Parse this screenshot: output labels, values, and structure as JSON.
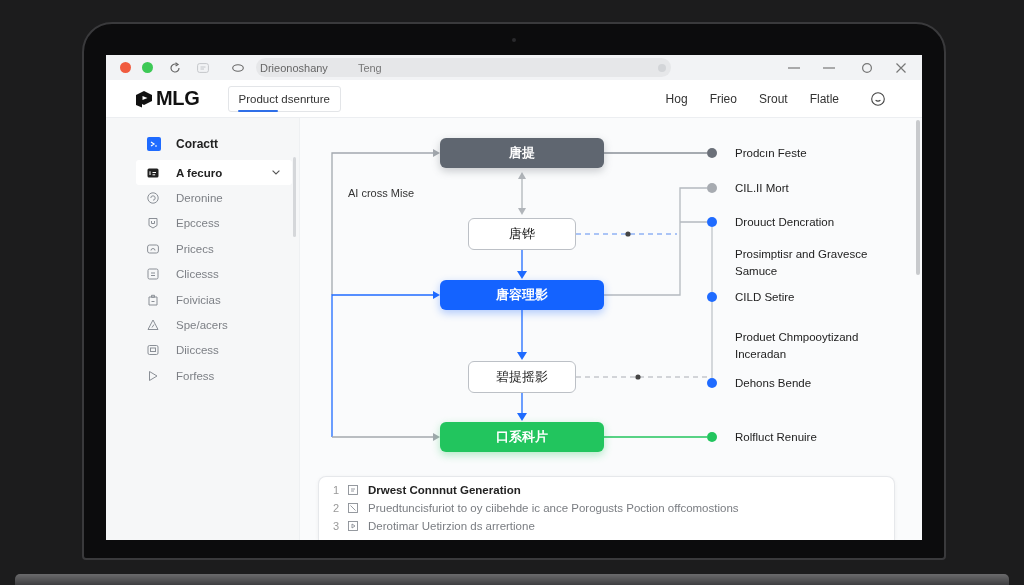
{
  "window": {
    "traffic_lights": [
      {
        "color": "#f05b3f"
      },
      {
        "color": "#3dc956"
      }
    ],
    "address_bar": {
      "value": "Drieonoshany",
      "suffix": "Teng"
    }
  },
  "header": {
    "logo": "MLG",
    "tabs": [
      {
        "label": "Product dsenrture",
        "selected": true
      }
    ],
    "nav": [
      "Hog",
      "Frieo",
      "Srout",
      "Flatle"
    ]
  },
  "sidebar": {
    "heading": "Coractt",
    "items": [
      {
        "label": "A fecuro",
        "selected": true,
        "expandable": true
      },
      {
        "label": "Deronine",
        "selected": false,
        "expandable": false
      },
      {
        "label": "Epccess",
        "selected": false,
        "expandable": false
      },
      {
        "label": "Pricecs",
        "selected": false,
        "expandable": false
      },
      {
        "label": "Clicesss",
        "selected": false,
        "expandable": false
      },
      {
        "label": "Foivicias",
        "selected": false,
        "expandable": false
      },
      {
        "label": "Spe/acers",
        "selected": false,
        "expandable": false
      },
      {
        "label": "Diiccess",
        "selected": false,
        "expandable": false
      },
      {
        "label": "Forfess",
        "selected": false,
        "expandable": false
      }
    ]
  },
  "diagram": {
    "note": "AI cross Mise",
    "nodes": [
      {
        "label": "唐提",
        "kind": "filled",
        "color": "#5f6670"
      },
      {
        "label": "唐铧",
        "kind": "outline"
      },
      {
        "label": "唐容理影",
        "kind": "filled",
        "color": "#1463ff"
      },
      {
        "label": "碧提摇影",
        "kind": "outline"
      },
      {
        "label": "口系科片",
        "kind": "filled",
        "color": "#22c55e"
      }
    ],
    "outputs": [
      {
        "label": "Prodcın Feste",
        "kind": "dot",
        "color": "#6b7079"
      },
      {
        "label": "CIL.II Mort",
        "kind": "dot",
        "color": "#a7abb1"
      },
      {
        "label": "Drouuct Dencration",
        "kind": "dot",
        "color": "#1f6bff"
      },
      {
        "label": "Prosimptisr and Gravesce Samuce",
        "kind": "note"
      },
      {
        "label": "CILD Setire",
        "kind": "dot",
        "color": "#1f6bff"
      },
      {
        "label": "Produet Chmpooytizand Inceradan",
        "kind": "note"
      },
      {
        "label": "Dehons Bende",
        "kind": "dot",
        "color": "#1f6bff"
      },
      {
        "label": "Rolfluct Renuire",
        "kind": "dot",
        "color": "#22c55e"
      }
    ]
  },
  "list": {
    "rows": [
      {
        "number": "1",
        "text": "Drwest Connnut Generation",
        "selected": true
      },
      {
        "number": "2",
        "text": "Pruedtuncisfuriot to oy ciibehde ic ance Porogusts Poction offcomostions",
        "selected": false
      },
      {
        "number": "3",
        "text": "Derotimar Uetirzion ds arrertione",
        "selected": false
      }
    ]
  }
}
